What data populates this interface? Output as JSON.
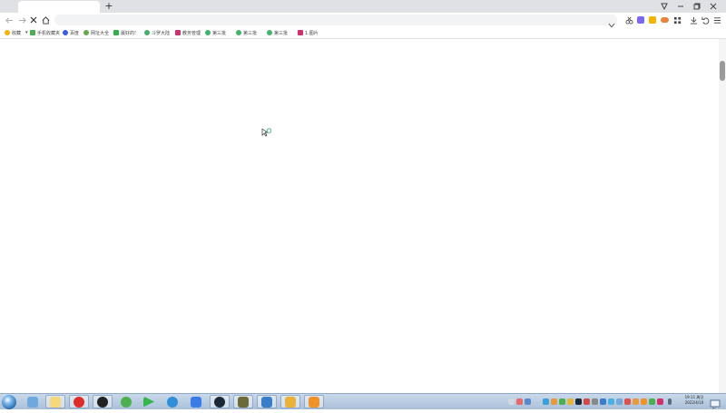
{
  "browser": {
    "new_tab_symbol": "+",
    "address_placeholder": "",
    "address_value": ""
  },
  "bookmarks": [
    {
      "label": "收藏",
      "color": "#f5b400"
    },
    {
      "label": "手机收藏夹",
      "color": "#4caf50"
    },
    {
      "label": "百度",
      "color": "#3a5ee0"
    },
    {
      "label": "网址大全",
      "color": "#6aa84f"
    },
    {
      "label": "最好的!",
      "color": "#2db34a"
    },
    {
      "label": "斗罗大陆",
      "color": "#43b36b"
    },
    {
      "label": "教务管理",
      "color": "#d12f6d"
    },
    {
      "label": "第三批",
      "color": "#43b36b"
    },
    {
      "label": "第三批",
      "color": "#43b36b"
    },
    {
      "label": "第三批",
      "color": "#43b36b"
    },
    {
      "label": "1.图片",
      "color": "#d12f6d"
    }
  ],
  "taskbar": {
    "apps": [
      {
        "name": "people-icon",
        "color": "#6fa8dc"
      },
      {
        "name": "folder-icon",
        "color": "#f6d67a"
      },
      {
        "name": "netease-music-icon",
        "color": "#e02b2b"
      },
      {
        "name": "obs-icon",
        "color": "#222222"
      },
      {
        "name": "green-app-icon",
        "color": "#4caf50"
      },
      {
        "name": "video-player-icon",
        "color": "#35b54a"
      },
      {
        "name": "browser-icon",
        "color": "#2f8fd8"
      },
      {
        "name": "feishu-icon",
        "color": "#3b7de8"
      },
      {
        "name": "steam-icon",
        "color": "#1b2838"
      },
      {
        "name": "game-icon",
        "color": "#6b6b3a"
      },
      {
        "name": "settings-app-icon",
        "color": "#3a7ec9"
      },
      {
        "name": "emoji-app-icon",
        "color": "#e8b23b"
      },
      {
        "name": "help-icon",
        "color": "#f0922a"
      }
    ],
    "clock_time": "19:11 周日",
    "clock_date": "2022/4/10"
  },
  "colors": {
    "accent": "#4caf9a",
    "tab_bg": "#dfe1e5"
  }
}
